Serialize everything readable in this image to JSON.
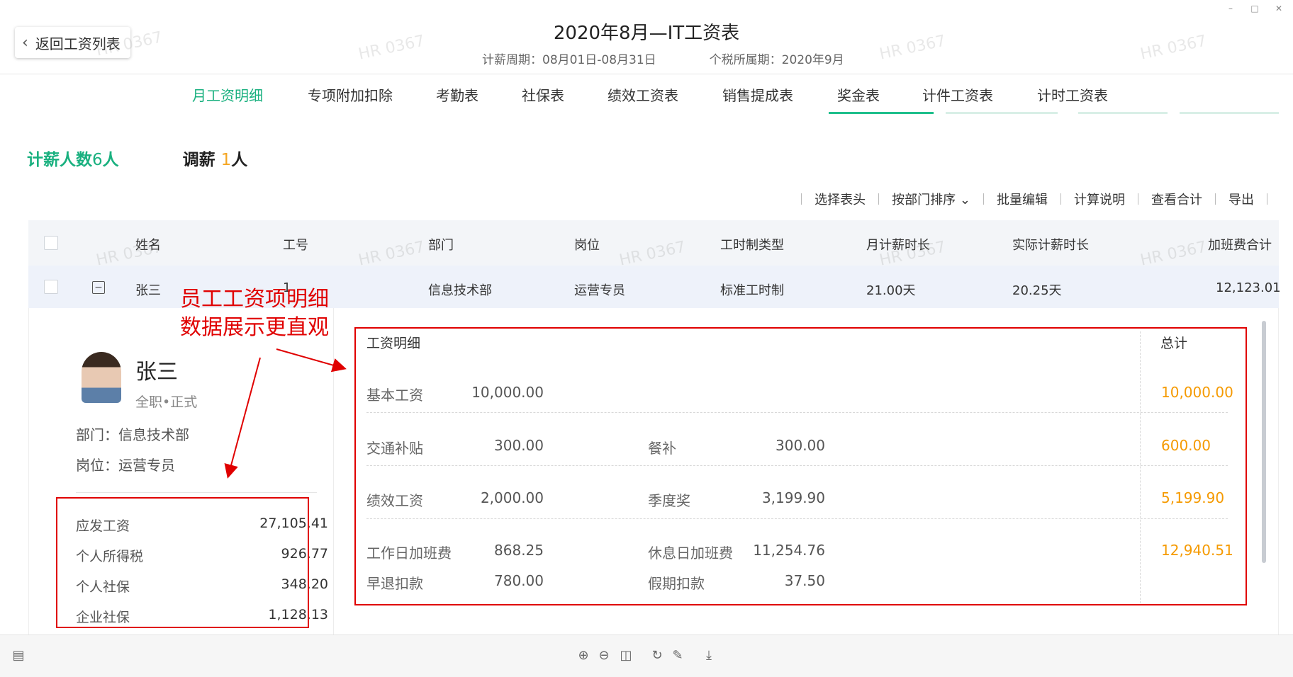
{
  "header": {
    "back_label": "返回工资列表",
    "title": "2020年8月—IT工资表",
    "period": "计薪周期：08月01日-08月31日",
    "tax_period": "个税所属期：2020年9月"
  },
  "tabs": [
    {
      "label": "月工资明细"
    },
    {
      "label": "专项附加扣除"
    },
    {
      "label": "考勤表"
    },
    {
      "label": "社保表"
    },
    {
      "label": "绩效工资表"
    },
    {
      "label": "销售提成表"
    },
    {
      "label": "奖金表"
    },
    {
      "label": "计件工资表"
    },
    {
      "label": "计时工资表"
    }
  ],
  "stats": {
    "headcount_label": "计薪人数",
    "headcount_value": "6",
    "headcount_unit": "人",
    "adjust_label": "调薪",
    "adjust_value": "1",
    "adjust_unit": "人"
  },
  "toolbar": {
    "select_header": "选择表头",
    "sort_by_dept": "按部门排序",
    "batch_edit": "批量编辑",
    "calc_notes": "计算说明",
    "view_total": "查看合计",
    "export": "导出"
  },
  "table": {
    "columns": [
      "姓名",
      "工号",
      "部门",
      "岗位",
      "工时制类型",
      "月计薪时长",
      "实际计薪时长",
      "加班费合计"
    ],
    "row": [
      "张三",
      "1",
      "信息技术部",
      "运营专员",
      "标准工时制",
      "21.00天",
      "20.25天",
      "12,123.01"
    ]
  },
  "employee": {
    "name": "张三",
    "type": "全职•正式",
    "dept": "部门：信息技术部",
    "position": "岗位：运营专员"
  },
  "summary": [
    {
      "label": "应发工资",
      "value": "27,105.41"
    },
    {
      "label": "个人所得税",
      "value": "926.77"
    },
    {
      "label": "个人社保",
      "value": "348.20"
    },
    {
      "label": "企业社保",
      "value": "1,128.13"
    }
  ],
  "annotation": {
    "line1": "员工工资项明细",
    "line2": "数据展示更直观"
  },
  "salary_detail": {
    "heading": "工资明细",
    "total_heading": "总计",
    "items": {
      "base_label": "基本工资",
      "base_value": "10,000.00",
      "base_total": "10,000.00",
      "transport_label": "交通补贴",
      "transport_value": "300.00",
      "meal_label": "餐补",
      "meal_value": "300.00",
      "allowance_total": "600.00",
      "perf_label": "绩效工资",
      "perf_value": "2,000.00",
      "quarter_label": "季度奖",
      "quarter_value": "3,199.90",
      "bonus_total": "5,199.90",
      "weekday_ot_label": "工作日加班费",
      "weekday_ot_value": "868.25",
      "restday_ot_label": "休息日加班费",
      "restday_ot_value": "11,254.76",
      "ot_total": "12,940.51",
      "early_leave_label": "早退扣款",
      "early_leave_value": "780.00",
      "holiday_ded_label": "假期扣款",
      "holiday_ded_value": "37.50"
    }
  },
  "watermark": "HR 0367",
  "colors": {
    "accent": "#19b07f",
    "highlight": "#f59a00",
    "annotation": "#e00000"
  }
}
